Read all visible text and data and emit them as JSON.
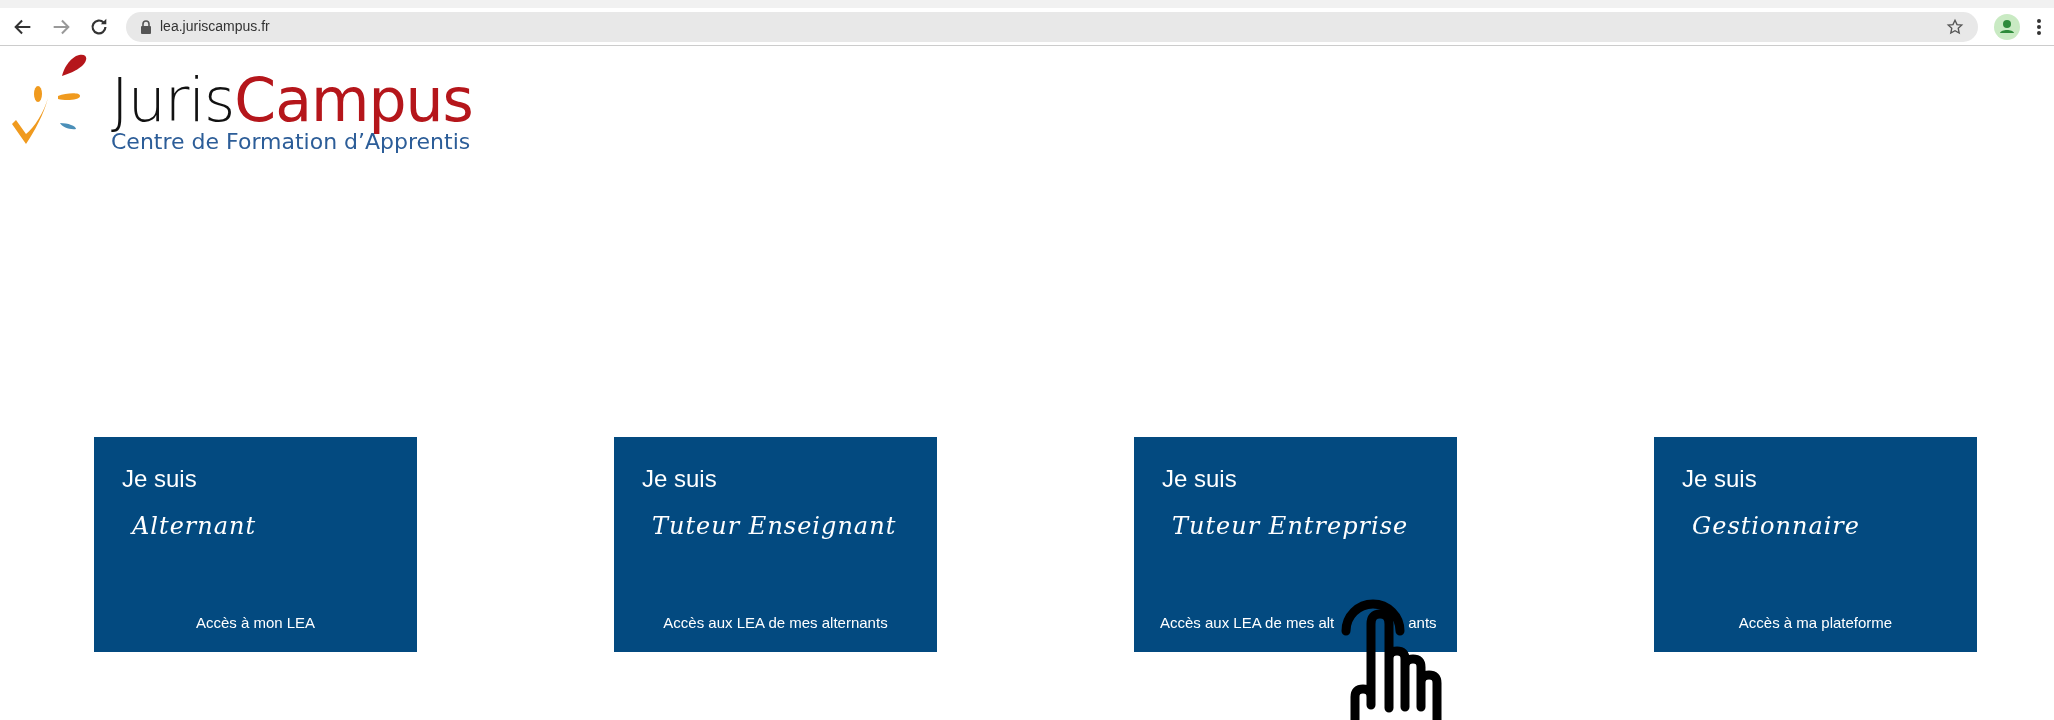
{
  "browser": {
    "url": "lea.juriscampus.fr"
  },
  "logo": {
    "name_first": "Juris",
    "name_second": "Campus",
    "tagline": "Centre de Formation d’Apprentis"
  },
  "cards": [
    {
      "heading": "Je suis",
      "role": "Alternant",
      "link": "Accès à mon LEA"
    },
    {
      "heading": "Je suis",
      "role": "Tuteur Enseignant",
      "link": "Accès aux LEA de mes alternants"
    },
    {
      "heading": "Je suis",
      "role": "Tuteur Entreprise",
      "link": "Accès aux LEA de mes alt",
      "link_tail": "ants"
    },
    {
      "heading": "Je suis",
      "role": "Gestionnaire",
      "link": "Accès à ma plateforme"
    }
  ]
}
